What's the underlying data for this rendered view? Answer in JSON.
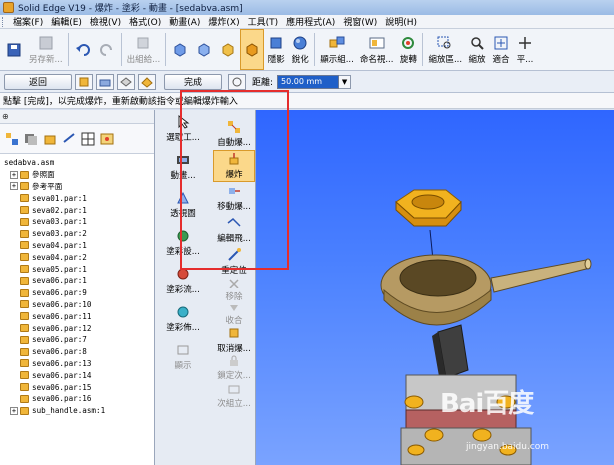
{
  "window": {
    "title": "Solid Edge V19 - 爆炸 - 塗彩 - 動畫 - [sedabva.asm]"
  },
  "menu": [
    "檔案(F)",
    "編輯(E)",
    "檢視(V)",
    "格式(O)",
    "動畫(A)",
    "爆炸(X)",
    "工具(T)",
    "應用程式(A)",
    "視窗(W)",
    "說明(H)"
  ],
  "toolbar": {
    "save_as": "另存新...",
    "export": "出組給...",
    "hide": "隱影",
    "sharpen": "銳化",
    "show_group": "顯示組...",
    "rename": "命名視...",
    "rotate": "旋轉",
    "zoom_area": "縮放區...",
    "zoom": "縮放",
    "fit": "適合",
    "pan": "平..."
  },
  "cmdbar": {
    "return": "返回",
    "finish": "完成",
    "distance_label": "距離:",
    "distance_value": "50.00 mm"
  },
  "prompt": "點擊 [完成]，以完成爆炸，重新啟動該指令或編輯爆炸輸入",
  "tree": {
    "root": "sedabva.asm",
    "items": [
      {
        "label": "參照面",
        "kind": "exp"
      },
      {
        "label": "參考平面",
        "kind": "exp"
      },
      {
        "label": "seva01.par:1",
        "kind": "part"
      },
      {
        "label": "seva02.par:1",
        "kind": "part"
      },
      {
        "label": "seva03.par:1",
        "kind": "part"
      },
      {
        "label": "seva03.par:2",
        "kind": "part"
      },
      {
        "label": "seva04.par:1",
        "kind": "part"
      },
      {
        "label": "seva04.par:2",
        "kind": "part"
      },
      {
        "label": "seva05.par:1",
        "kind": "part"
      },
      {
        "label": "seva06.par:1",
        "kind": "part"
      },
      {
        "label": "seva06.par:9",
        "kind": "part"
      },
      {
        "label": "seva06.par:10",
        "kind": "part"
      },
      {
        "label": "seva06.par:11",
        "kind": "part"
      },
      {
        "label": "seva06.par:12",
        "kind": "part"
      },
      {
        "label": "seva06.par:7",
        "kind": "part"
      },
      {
        "label": "seva06.par:8",
        "kind": "part"
      },
      {
        "label": "seva06.par:13",
        "kind": "part"
      },
      {
        "label": "seva06.par:14",
        "kind": "part"
      },
      {
        "label": "seva06.par:15",
        "kind": "part"
      },
      {
        "label": "seva06.par:16",
        "kind": "part"
      },
      {
        "label": "sub_handle.asm:1",
        "kind": "exp"
      }
    ]
  },
  "side_tools_a": [
    "選取工...",
    "動畫...",
    "透視圖",
    "塗彩設...",
    "塗彩流...",
    "塗彩佈...",
    "顯示"
  ],
  "side_tools_b": [
    "自動爆...",
    "爆炸",
    "移動爆...",
    "編輯飛...",
    "重定位",
    "移除",
    "收合",
    "取消爆...",
    "鎖定次...",
    "次組立..."
  ],
  "watermark": {
    "logo": "Bai百度",
    "sub": "jingyan.baidu.com"
  },
  "colors": {
    "highlight": "#e52d2d",
    "viewport": "#3b72ff",
    "active_tool": "#fbd88a"
  }
}
